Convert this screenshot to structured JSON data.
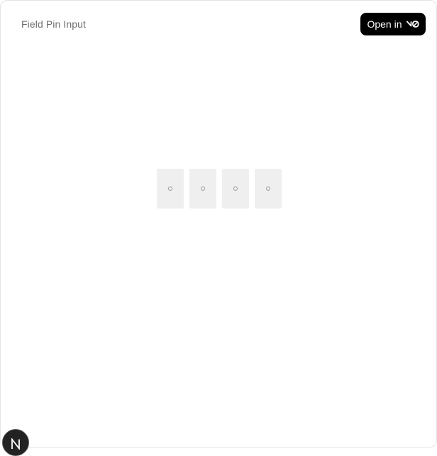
{
  "header": {
    "title": "Field Pin Input",
    "open_button_label": "Open in",
    "open_button_icon": "v0-logo-icon"
  },
  "pin_input": {
    "length": 4,
    "slots": [
      {
        "value": "",
        "placeholder": "○"
      },
      {
        "value": "",
        "placeholder": "○"
      },
      {
        "value": "",
        "placeholder": "○"
      },
      {
        "value": "",
        "placeholder": "○"
      }
    ],
    "slot_color": "#efefef"
  },
  "badge": {
    "icon": "nextjs-logo-icon"
  },
  "colors": {
    "button_bg": "#000000",
    "title_text": "#6e6e6e"
  }
}
